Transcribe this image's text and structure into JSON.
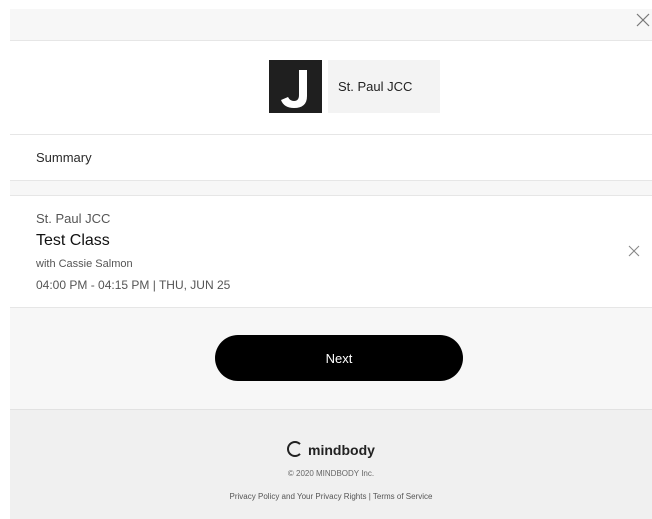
{
  "header": {
    "close_icon": "close-icon"
  },
  "logo": {
    "mark_letter": "J",
    "name": "St. Paul JCC"
  },
  "summary": {
    "title": "Summary"
  },
  "class": {
    "studio": "St. Paul JCC",
    "name": "Test Class",
    "teacher": "with Cassie Salmon",
    "time": "04:00 PM - 04:15 PM | THU, JUN 25",
    "remove_icon": "close-icon"
  },
  "actions": {
    "next_label": "Next"
  },
  "footer": {
    "brand": "mindbody",
    "copyright": "© 2020 MINDBODY Inc.",
    "privacy_link": "Privacy Policy and Your Privacy Rights",
    "separator": " | ",
    "terms_link": "Terms of Service"
  },
  "colors": {
    "button_bg": "#000000",
    "panel_bg": "#f7f7f7",
    "footer_bg": "#f0f0f0"
  }
}
